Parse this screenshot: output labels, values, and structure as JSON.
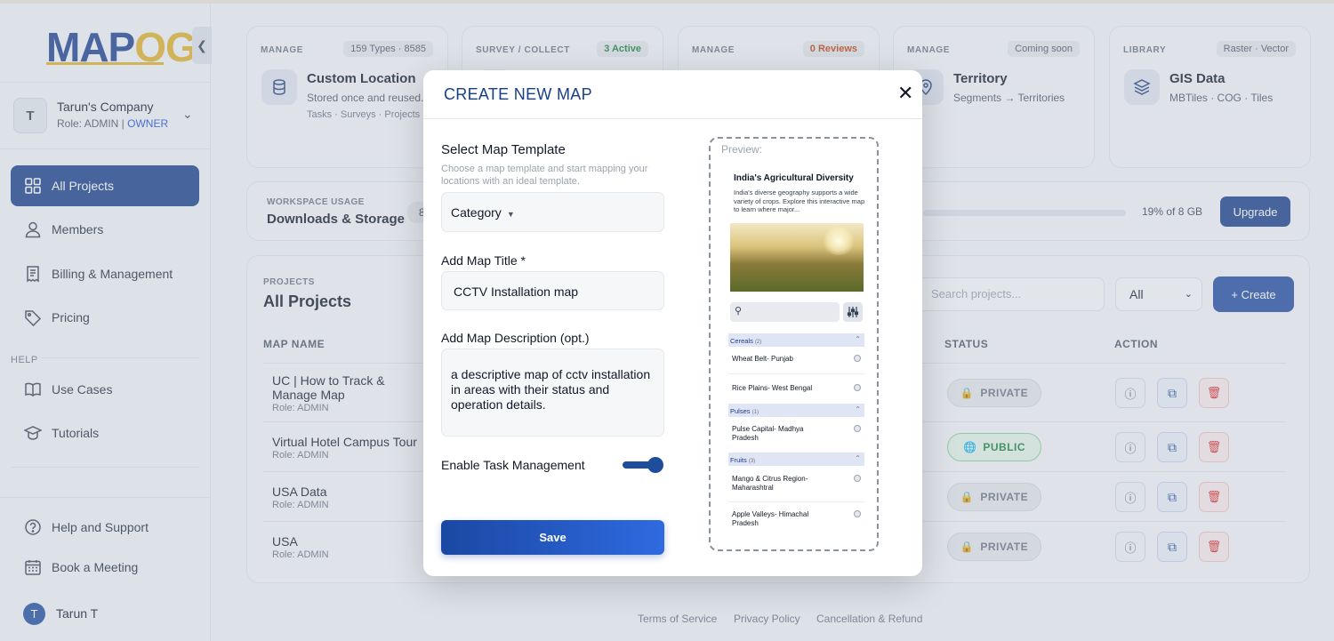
{
  "app": {
    "logo_main": "MAP",
    "logo_accent": "OG"
  },
  "sidebar": {
    "company": {
      "avatar": "T",
      "name": "Tarun's Company",
      "role_prefix": "Role: ADMIN | ",
      "role_owner": "OWNER"
    },
    "nav": [
      {
        "label": "All Projects",
        "icon": "grid-icon",
        "active": true
      },
      {
        "label": "Members",
        "icon": "user-icon"
      },
      {
        "label": "Billing & Management",
        "icon": "receipt-icon"
      },
      {
        "label": "Pricing",
        "icon": "tag-icon"
      }
    ],
    "help_label": "HELP",
    "help_nav": [
      {
        "label": "Use Cases",
        "icon": "book-icon"
      },
      {
        "label": "Tutorials",
        "icon": "graduation-cap-icon"
      }
    ],
    "bottom_nav": [
      {
        "label": "Help and Support",
        "icon": "question-circle-icon"
      },
      {
        "label": "Book a Meeting",
        "icon": "calendar-icon"
      }
    ],
    "user": {
      "avatar": "T",
      "name": "Tarun T"
    }
  },
  "cards": [
    {
      "label": "MANAGE",
      "badge": "159 Types · 8585",
      "title": "Custom Location",
      "sub": "Stored once and reused...",
      "meta": "Tasks · Surveys · Projects",
      "icon": "database-icon"
    },
    {
      "label": "SURVEY / COLLECT",
      "badge": "3 Active",
      "title": "",
      "sub": "",
      "meta": "",
      "icon": "clipboard-icon"
    },
    {
      "label": "MANAGE",
      "badge": "0 Reviews",
      "title": "",
      "sub": "",
      "meta": "",
      "icon": "check-icon"
    },
    {
      "label": "MANAGE",
      "badge": "Coming soon",
      "title": "Territory",
      "sub": "Segments → Territories",
      "meta": "",
      "icon": "location-pin-icon"
    },
    {
      "label": "LIBRARY",
      "badge": "Raster · Vector",
      "title": "GIS Data",
      "sub": "MBTiles · COG · Tiles",
      "meta": "",
      "icon": "layers-icon"
    }
  ],
  "usage": {
    "label": "WORKSPACE USAGE",
    "title": "Downloads & Storage",
    "chip": "8",
    "storage_text": "19% of 8 GB",
    "storage_fraction": 0.19,
    "upgrade": "Upgrade"
  },
  "projects": {
    "label": "PROJECTS",
    "title": "All Projects",
    "search_placeholder": "Search projects...",
    "filter_value": "All",
    "create_label": "+ Create",
    "columns": {
      "name": "MAP NAME",
      "status": "STATUS",
      "action": "ACTION"
    },
    "rows": [
      {
        "name": "UC | How to Track & Manage Map",
        "role": "Role: ADMIN",
        "status": "PRIVATE"
      },
      {
        "name": "Virtual Hotel Campus Tour",
        "role": "Role: ADMIN",
        "status": "PUBLIC"
      },
      {
        "name": "USA Data",
        "role": "Role: ADMIN",
        "status": "PRIVATE"
      },
      {
        "name": "USA",
        "role": "Role: ADMIN",
        "status": "PRIVATE"
      }
    ]
  },
  "footer": {
    "terms": "Terms of Service",
    "privacy": "Privacy Policy",
    "refund": "Cancellation & Refund"
  },
  "modal": {
    "title": "CREATE NEW MAP",
    "template_label": "Select Map Template",
    "template_help": "Choose a map template and start mapping your locations with an ideal template.",
    "category_value": "Category",
    "title_label": "Add Map Title *",
    "title_value": "CCTV Installation map",
    "desc_label": "Add Map Description (opt.)",
    "desc_value": "a descriptive map of cctv installation in areas with their status and operation details.",
    "task_label": "Enable Task Management",
    "task_enabled": true,
    "save_label": "Save",
    "preview": {
      "label": "Preview:",
      "title": "India's Agricultural Diversity",
      "desc": "India's diverse geography supports a wide variety of crops. Explore this interactive map to learn where major...",
      "categories": [
        {
          "name": "Cereals",
          "count": "(2)",
          "items": [
            "Wheat Belt- Punjab",
            "Rice Plains- West Bengal"
          ]
        },
        {
          "name": "Pulses",
          "count": "(1)",
          "items": [
            "Pulse Capital- Madhya Pradesh"
          ]
        },
        {
          "name": "Fruits",
          "count": "(3)",
          "items": [
            "Mango & Citrus Region- Maharashtral",
            "Apple Valleys- Himachal Pradesh"
          ]
        }
      ]
    }
  },
  "colors": {
    "primary": "#173f8a",
    "accent": "#e2b328",
    "public_green": "#15803d",
    "delete_red": "#dc2626"
  }
}
